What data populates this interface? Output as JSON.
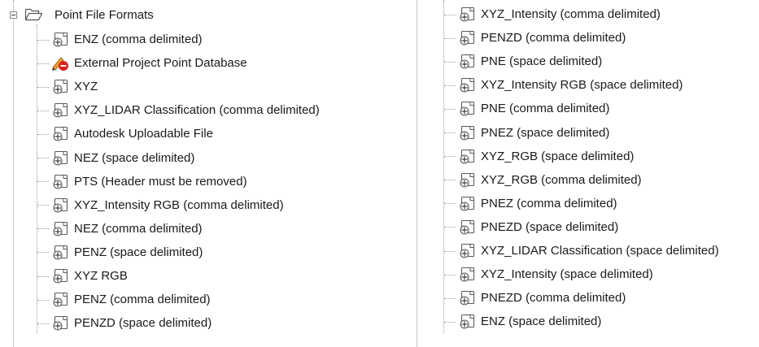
{
  "tree": {
    "group_label": "Point File Formats",
    "left_items": [
      {
        "label": "ENZ (comma delimited)",
        "icon": "point-format-icon"
      },
      {
        "label": "External Project Point Database",
        "icon": "external-database-icon"
      },
      {
        "label": "XYZ",
        "icon": "point-format-icon"
      },
      {
        "label": "XYZ_LIDAR Classification (comma delimited)",
        "icon": "point-format-icon"
      },
      {
        "label": "Autodesk Uploadable File",
        "icon": "point-format-icon"
      },
      {
        "label": "NEZ (space delimited)",
        "icon": "point-format-icon"
      },
      {
        "label": "PTS (Header must be removed)",
        "icon": "point-format-icon"
      },
      {
        "label": "XYZ_Intensity RGB (comma delimited)",
        "icon": "point-format-icon"
      },
      {
        "label": "NEZ (comma delimited)",
        "icon": "point-format-icon"
      },
      {
        "label": "PENZ (space delimited)",
        "icon": "point-format-icon"
      },
      {
        "label": "XYZ RGB",
        "icon": "point-format-icon"
      },
      {
        "label": "PENZ (comma delimited)",
        "icon": "point-format-icon"
      },
      {
        "label": "PENZD (space delimited)",
        "icon": "point-format-icon"
      }
    ],
    "right_items": [
      {
        "label": "XYZ_Intensity (comma delimited)",
        "icon": "point-format-icon"
      },
      {
        "label": "PENZD (comma delimited)",
        "icon": "point-format-icon"
      },
      {
        "label": "PNE (space delimited)",
        "icon": "point-format-icon"
      },
      {
        "label": "XYZ_Intensity RGB (space delimited)",
        "icon": "point-format-icon"
      },
      {
        "label": "PNE (comma delimited)",
        "icon": "point-format-icon"
      },
      {
        "label": "PNEZ (space delimited)",
        "icon": "point-format-icon"
      },
      {
        "label": "XYZ_RGB (space delimited)",
        "icon": "point-format-icon"
      },
      {
        "label": "XYZ_RGB (comma delimited)",
        "icon": "point-format-icon"
      },
      {
        "label": "PNEZ (comma delimited)",
        "icon": "point-format-icon"
      },
      {
        "label": "PNEZD (space delimited)",
        "icon": "point-format-icon"
      },
      {
        "label": "XYZ_LIDAR Classification (space delimited)",
        "icon": "point-format-icon"
      },
      {
        "label": "XYZ_Intensity (space delimited)",
        "icon": "point-format-icon"
      },
      {
        "label": "PNEZD (comma delimited)",
        "icon": "point-format-icon"
      },
      {
        "label": "ENZ (space delimited)",
        "icon": "point-format-icon"
      }
    ]
  },
  "colors": {
    "connector": "#9a9a9a",
    "icon_outline": "#5a5a5a",
    "error_badge": "#d9241c",
    "pencil": "#f0a030"
  }
}
